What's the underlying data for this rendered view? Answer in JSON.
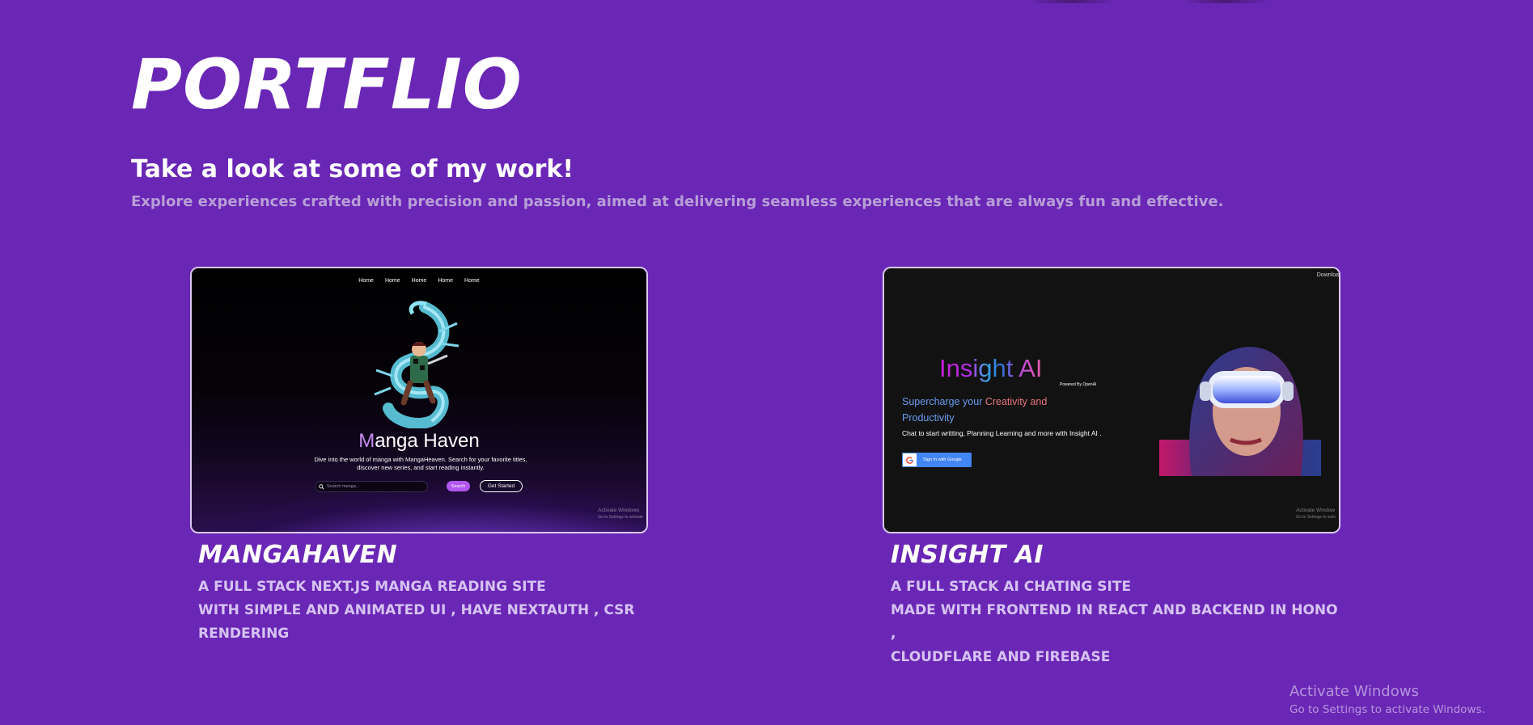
{
  "page": {
    "title": "PORTFLIO",
    "heading": "Take a look at some of my work!",
    "subtitle": "Explore experiences crafted with precision and passion, aimed at delivering seamless experiences that are always fun and effective."
  },
  "projects": [
    {
      "name": "MANGAHAVEN",
      "description_lines": [
        "A FULL STACK NEXT.JS MANGA READING SITE",
        "WITH SIMPLE AND ANIMATED UI , HAVE NEXTAUTH , CSR",
        "RENDERING"
      ],
      "preview": {
        "nav_items": [
          "Home",
          "Home",
          "Home",
          "Home",
          "Home"
        ],
        "title_prefix": "M",
        "title_rest": "anga Haven",
        "text": "Dive into the world of manga with MangaHeaven. Search for your favorite titles, discover new series, and start reading instantly.",
        "search_placeholder": "Search manga...",
        "search_button": "Search",
        "cta_button": "Get Started",
        "watermark_line1": "Activate Windows",
        "watermark_line2": "Go to Settings to activate"
      }
    },
    {
      "name": "INSIGHT AI",
      "description_lines": [
        "A FULL STACK AI CHATING SITE",
        "MADE WITH FRONTEND IN REACT AND BACKEND IN HONO ,",
        "CLOUDFLARE AND FIREBASE"
      ],
      "preview": {
        "download_label": "Downloa",
        "brand": "Insight AI",
        "powered_by": "Powered By OpenAI",
        "tagline_part1": "Supercharge your ",
        "tagline_part2": "Creativity and",
        "tagline_part3": "Productivity",
        "description": "Chat to start writting, Planning Learning and more with Insight AI .",
        "google_button": "Sign In with Google",
        "watermark_line1": "Activate Window",
        "watermark_line2": "Go to Settings to activ"
      }
    }
  ],
  "watermark": {
    "title": "Activate Windows",
    "subtitle": "Go to Settings to activate Windows."
  },
  "colors": {
    "background": "#6a27b6",
    "subtitle": "#b79fd6",
    "description": "#d6c3f2",
    "google_blue": "#4285f4"
  }
}
